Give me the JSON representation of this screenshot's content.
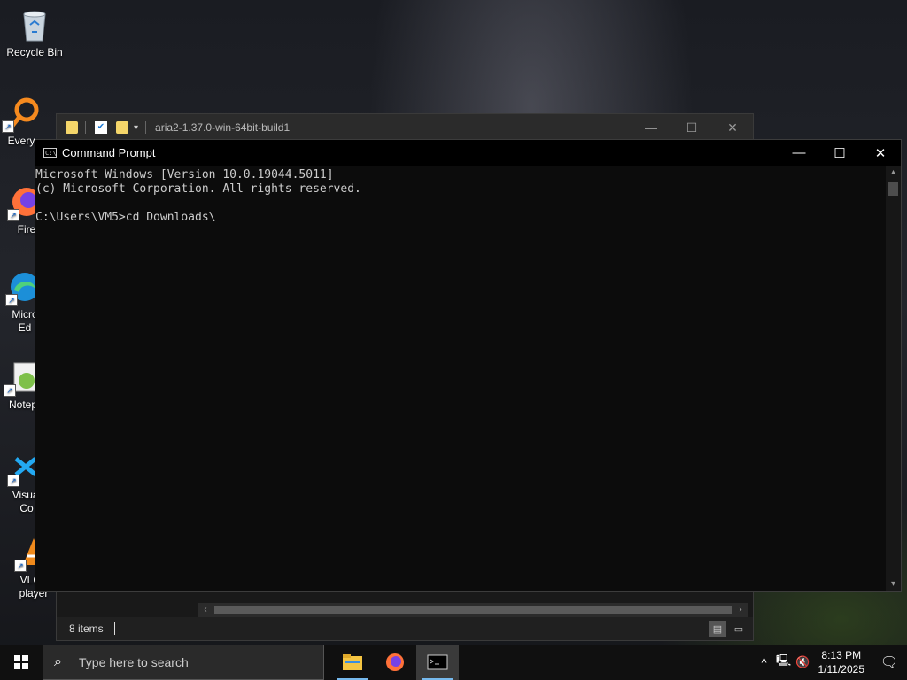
{
  "desktop": {
    "icons": [
      {
        "label": "Recycle Bin"
      },
      {
        "label": "Every"
      },
      {
        "label": "Fire"
      },
      {
        "label_line1": "Micro",
        "label_line2": "Ed"
      },
      {
        "label": "Notep"
      },
      {
        "label_line1": "Visual",
        "label_line2": "Co"
      },
      {
        "label_line1": "VLC r",
        "label_line2": "player"
      }
    ]
  },
  "explorer": {
    "title": "aria2-1.37.0-win-64bit-build1",
    "status_items": "8 items"
  },
  "cmd": {
    "title": "Command Prompt",
    "console_lines": [
      "Microsoft Windows [Version 10.0.19044.5011]",
      "(c) Microsoft Corporation. All rights reserved.",
      "",
      "C:\\Users\\VM5>cd Downloads\\"
    ]
  },
  "taskbar": {
    "search_placeholder": "Type here to search",
    "apps": [
      {
        "name": "file-explorer-icon",
        "active": false
      },
      {
        "name": "firefox-icon",
        "active": false
      },
      {
        "name": "command-prompt-icon",
        "active": true
      }
    ],
    "clock": {
      "time": "8:13 PM",
      "date": "1/11/2025"
    }
  },
  "colors": {
    "console_text": "#cccccc",
    "console_bg": "#0c0c0c",
    "taskbar_accent": "#76b9ed"
  }
}
